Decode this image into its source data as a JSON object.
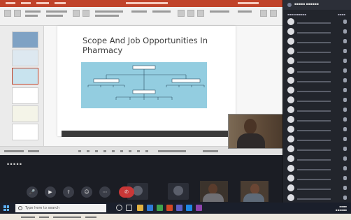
{
  "slide": {
    "title": "Scope And Job Opportunities In Pharmacy"
  },
  "taskbar": {
    "search_placeholder": "Type here to search"
  },
  "colors": {
    "ribbon_accent": "#c0432a",
    "diagram_fill": "#93cde0",
    "meeting_background": "#1b1d24",
    "participants_panel": "#22252c",
    "hangup": "#c93737"
  },
  "icons": {
    "controls": [
      "mic-icon",
      "video-icon",
      "share-screen-icon",
      "emoji-icon",
      "more-icon",
      "hang-up-icon"
    ],
    "taskbar": [
      "windows-start-icon",
      "search-icon",
      "task-view-icon",
      "file-explorer-icon",
      "browser-icon",
      "powerpoint-icon",
      "teams-icon"
    ]
  }
}
